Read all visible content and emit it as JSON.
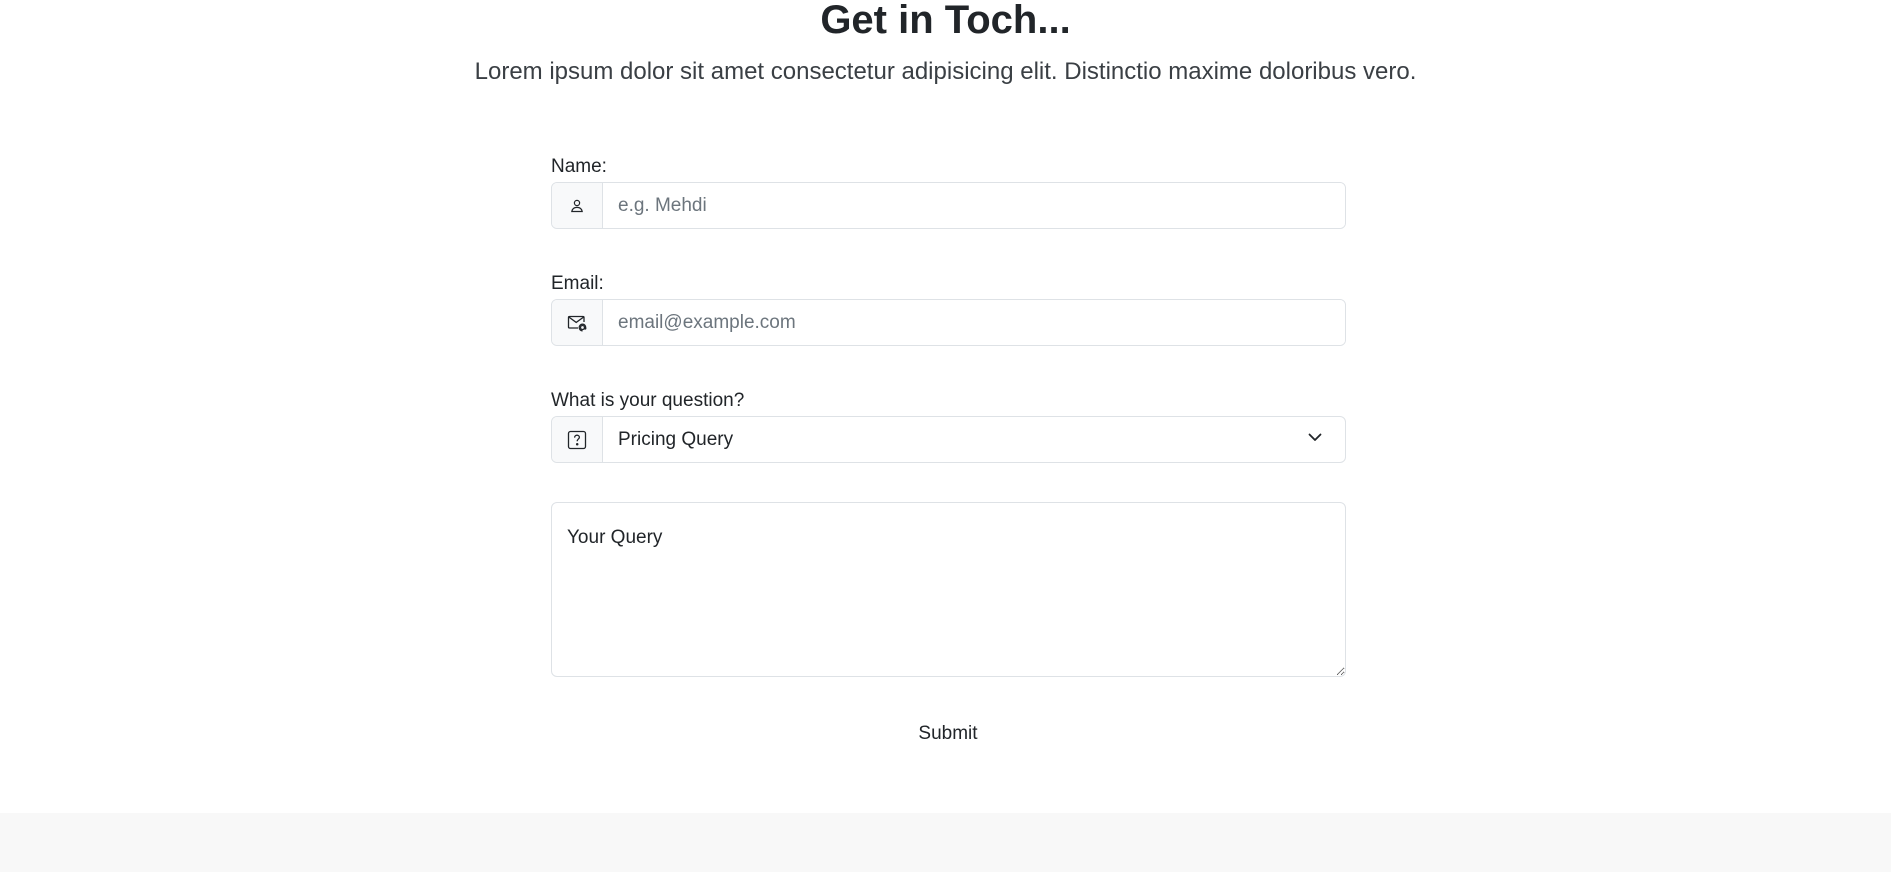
{
  "header": {
    "title": "Get in Toch...",
    "subtitle": "Lorem ipsum dolor sit amet consectetur adipisicing elit. Distinctio maxime doloribus vero."
  },
  "form": {
    "name": {
      "label": "Name:",
      "placeholder": "e.g. Mehdi",
      "icon": "person-icon"
    },
    "email": {
      "label": "Email:",
      "placeholder": "email@example.com",
      "icon": "envelope-at-icon"
    },
    "question": {
      "label": "What is your question?",
      "selected": "Pricing Query",
      "icon": "question-square-icon"
    },
    "query": {
      "placeholder": "Your Query"
    },
    "submit_label": "Submit"
  },
  "colors": {
    "text": "#212529",
    "border": "#dee2e6",
    "addon_bg": "#f8f9fa",
    "footer_bg": "#f8f8f8"
  }
}
